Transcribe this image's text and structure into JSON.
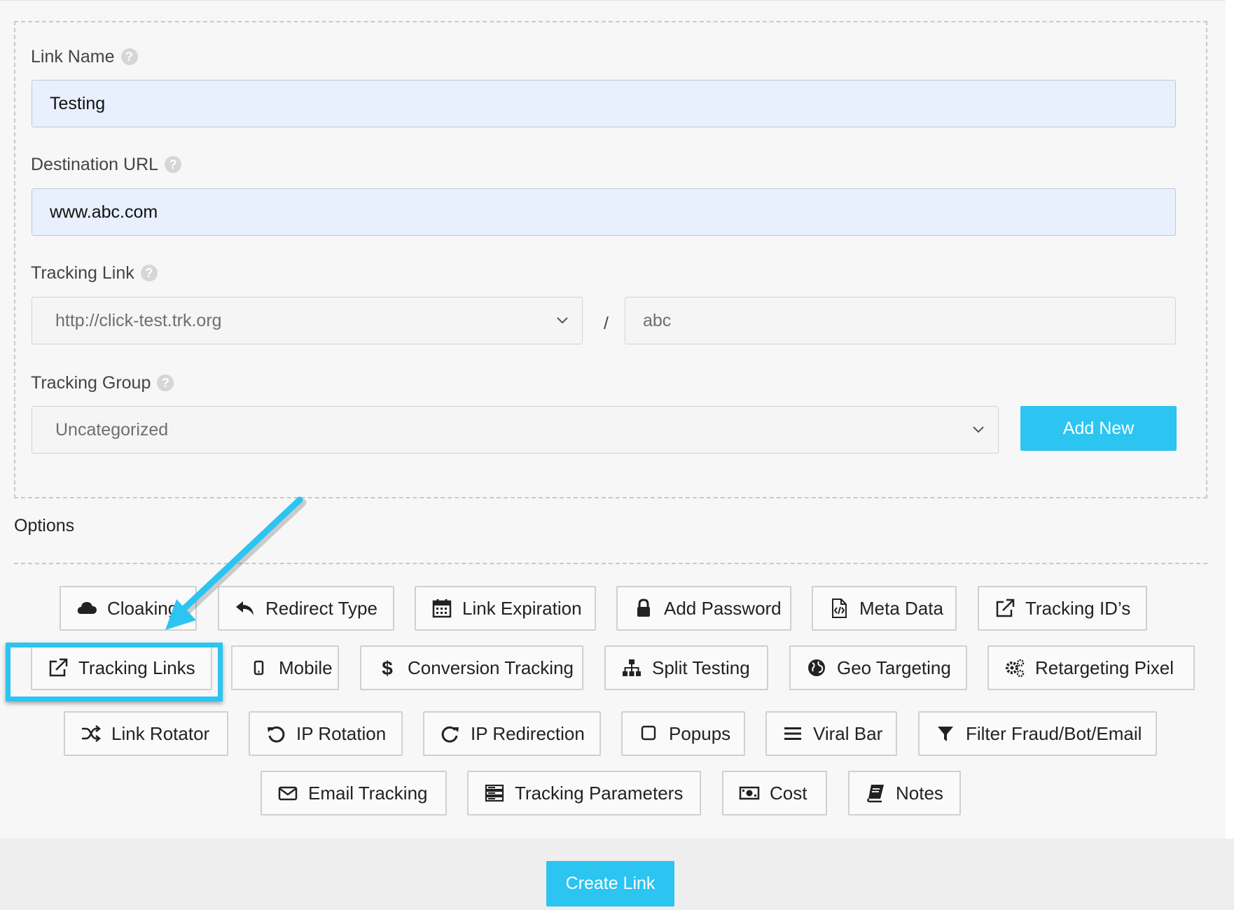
{
  "form": {
    "link_name": {
      "label": "Link Name",
      "value": "Testing"
    },
    "destination_url": {
      "label": "Destination URL",
      "value": "www.abc.com"
    },
    "tracking_link": {
      "label": "Tracking Link",
      "domain": "http://click-test.trk.org",
      "separator": "/",
      "slug": "abc"
    },
    "tracking_group": {
      "label": "Tracking Group",
      "value": "Uncategorized",
      "add_new_label": "Add New"
    }
  },
  "options": {
    "title": "Options",
    "buttons": [
      {
        "label": "Cloaking",
        "icon": "cloud-icon"
      },
      {
        "label": "Redirect Type",
        "icon": "reply-icon"
      },
      {
        "label": "Link Expiration",
        "icon": "calendar-icon"
      },
      {
        "label": "Add Password",
        "icon": "lock-icon"
      },
      {
        "label": "Meta Data",
        "icon": "code-file-icon"
      },
      {
        "label": "Tracking ID’s",
        "icon": "external-link-icon"
      },
      {
        "label": "Tracking Links",
        "icon": "external-link-icon"
      },
      {
        "label": "Mobile",
        "icon": "mobile-icon"
      },
      {
        "label": "Conversion Tracking",
        "icon": "dollar-icon"
      },
      {
        "label": "Split Testing",
        "icon": "sitemap-icon"
      },
      {
        "label": "Geo Targeting",
        "icon": "globe-icon"
      },
      {
        "label": "Retargeting Pixel",
        "icon": "gears-icon"
      },
      {
        "label": "Link Rotator",
        "icon": "random-icon"
      },
      {
        "label": "IP Rotation",
        "icon": "undo-icon"
      },
      {
        "label": "IP Redirection",
        "icon": "redo-icon"
      },
      {
        "label": "Popups",
        "icon": "square-icon"
      },
      {
        "label": "Viral Bar",
        "icon": "bars-icon"
      },
      {
        "label": "Filter Fraud/Bot/Email",
        "icon": "filter-icon"
      },
      {
        "label": "Email Tracking",
        "icon": "envelope-icon"
      },
      {
        "label": "Tracking Parameters",
        "icon": "server-icon"
      },
      {
        "label": "Cost",
        "icon": "money-bill-icon"
      },
      {
        "label": "Notes",
        "icon": "book-icon"
      }
    ]
  },
  "footer": {
    "create_label": "Create Link"
  },
  "colors": {
    "accent": "#2cc4f0",
    "input_fill": "#e8f0fe",
    "panel_bg": "#f7f7f7"
  }
}
